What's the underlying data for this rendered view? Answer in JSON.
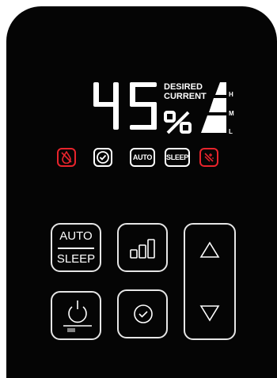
{
  "display": {
    "humidity_value": "45",
    "unit": "%",
    "desired_label": "DESIRED",
    "current_label": "CURRENT",
    "level_labels": {
      "high": "H",
      "medium": "M",
      "low": "L"
    }
  },
  "indicators": [
    {
      "name": "no-water-icon",
      "color": "#e8242c"
    },
    {
      "name": "timer-icon",
      "color": "#ffffff"
    },
    {
      "name": "auto-indicator",
      "label": "AUTO",
      "color": "#ffffff"
    },
    {
      "name": "sleep-indicator",
      "label": "SLEEP",
      "color": "#ffffff"
    },
    {
      "name": "clean-filter-icon",
      "color": "#e8242c"
    }
  ],
  "buttons": {
    "auto_sleep": {
      "top_label": "AUTO",
      "bottom_label": "SLEEP"
    },
    "fan_speed": {
      "icon": "fan-speed-icon"
    },
    "power": {
      "icon": "power-icon"
    },
    "timer": {
      "icon": "timer-icon"
    },
    "up": {
      "icon": "up-arrow-icon"
    },
    "down": {
      "icon": "down-arrow-icon"
    }
  },
  "colors": {
    "panel": "#050505",
    "foreground": "#ffffff",
    "alert": "#e8242c"
  }
}
